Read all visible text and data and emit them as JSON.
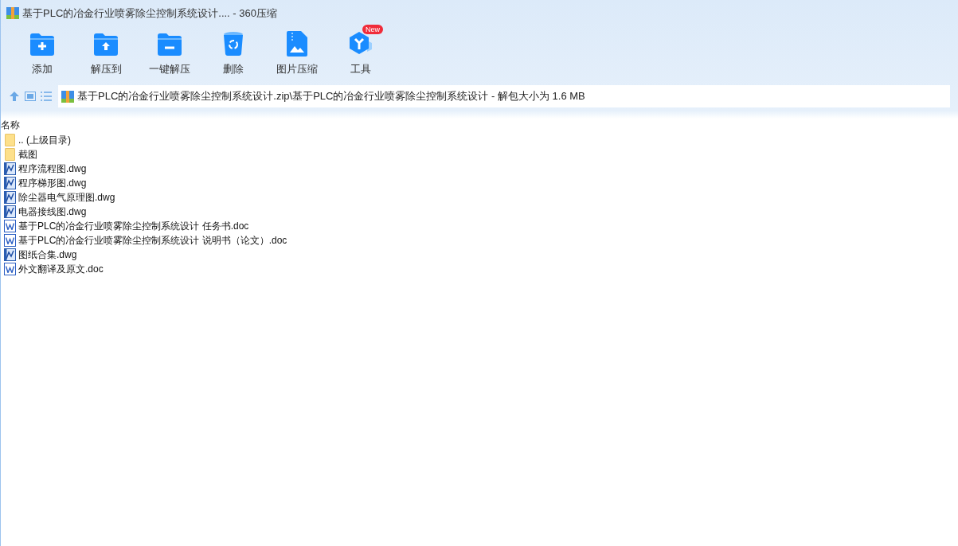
{
  "window": {
    "title": "基于PLC的冶金行业喷雾除尘控制系统设计.... - 360压缩"
  },
  "toolbar": [
    {
      "label": "添加",
      "kind": "add"
    },
    {
      "label": "解压到",
      "kind": "extract"
    },
    {
      "label": "一键解压",
      "kind": "oneclick"
    },
    {
      "label": "删除",
      "kind": "delete"
    },
    {
      "label": "图片压缩",
      "kind": "image"
    },
    {
      "label": "工具",
      "kind": "tools",
      "badge": "New"
    }
  ],
  "address": {
    "path": "基于PLC的冶金行业喷雾除尘控制系统设计.zip\\基于PLC的冶金行业喷雾除尘控制系统设计 - 解包大小为 1.6 MB"
  },
  "list": {
    "columns": [
      "名称"
    ],
    "rows": [
      {
        "name": ".. (上级目录)",
        "kind": "folder"
      },
      {
        "name": "截图",
        "kind": "folder"
      },
      {
        "name": "程序流程图.dwg",
        "kind": "dwg"
      },
      {
        "name": "程序梯形图.dwg",
        "kind": "dwg"
      },
      {
        "name": "除尘器电气原理图.dwg",
        "kind": "dwg"
      },
      {
        "name": "电器接线图.dwg",
        "kind": "dwg"
      },
      {
        "name": "基于PLC的冶金行业喷雾除尘控制系统设计 任务书.doc",
        "kind": "doc"
      },
      {
        "name": "基于PLC的冶金行业喷雾除尘控制系统设计 说明书（论文）.doc",
        "kind": "doc"
      },
      {
        "name": "图纸合集.dwg",
        "kind": "dwg"
      },
      {
        "name": "外文翻译及原文.doc",
        "kind": "doc"
      }
    ]
  }
}
